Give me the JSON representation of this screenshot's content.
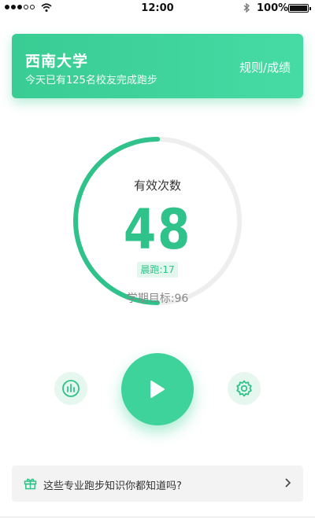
{
  "status_bar": {
    "time": "12:00",
    "battery": "100%"
  },
  "header": {
    "university": "西南大学",
    "subtitle": "今天已有125名校友完成跑步",
    "rules_link": "规则/成绩"
  },
  "progress": {
    "label": "有效次数",
    "value": "48",
    "morning_run": "晨跑:17",
    "goal": "学期目标:96",
    "fraction": 0.5
  },
  "controls": {
    "left_icon": "bar-chart-icon",
    "center_icon": "play-icon",
    "right_icon": "gear-icon"
  },
  "tips": {
    "text": "这些专业跑步知识你都知道吗?",
    "icon": "gift-icon"
  },
  "colors": {
    "accent": "#3fd39c",
    "accent_dark": "#2fc28a",
    "accent_light": "#e5f7ef",
    "track": "#eeeeee"
  }
}
